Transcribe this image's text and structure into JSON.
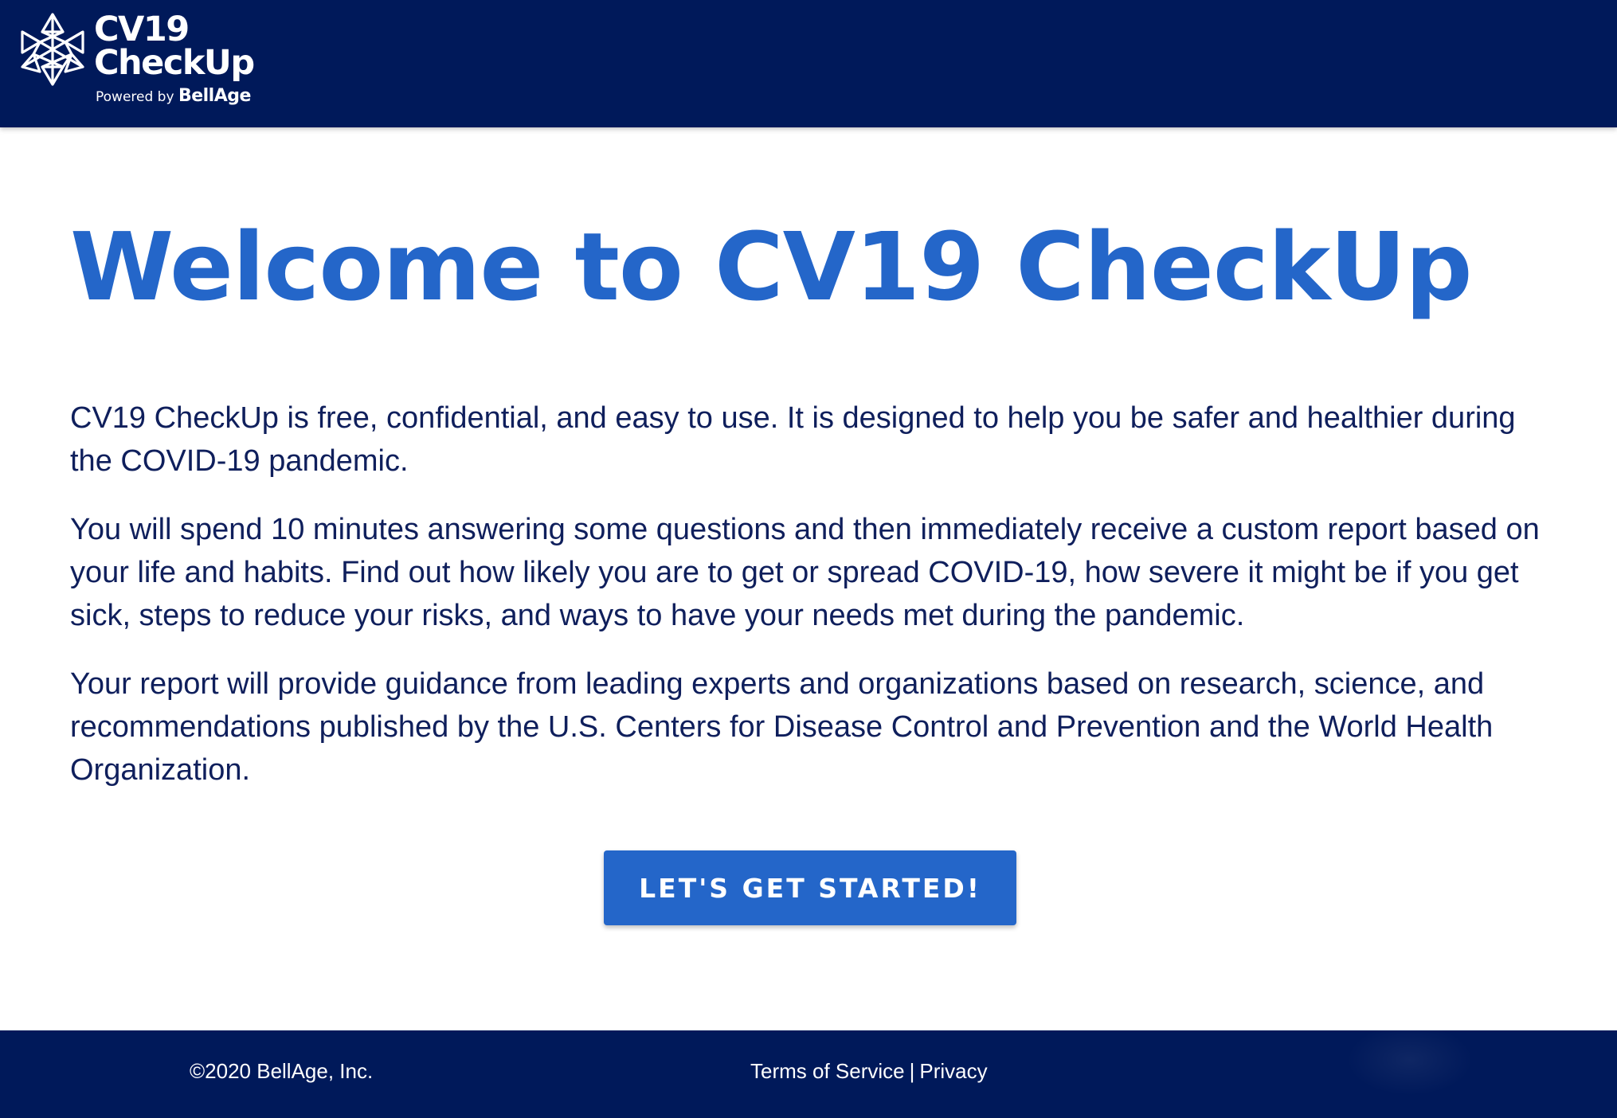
{
  "header": {
    "logo": {
      "title_line1": "CV19",
      "title_line2": "CheckUp",
      "powered_prefix": "Powered by",
      "powered_brand": "BellAge",
      "icon": "snowflake-network-icon"
    },
    "background_color": "#00195a"
  },
  "main": {
    "heading": "Welcome to CV19 CheckUp",
    "paragraphs": [
      "CV19 CheckUp is free, confidential, and easy to use. It is designed to help you be safer and healthier during the COVID-19 pandemic.",
      "You will spend 10 minutes answering some questions and then immediately receive a custom report based on your life and habits. Find out how likely you are to get or spread COVID-19, how severe it might be if you get sick, steps to reduce your risks, and ways to have your needs met during the pandemic.",
      "Your report will provide guidance from leading experts and organizations based on research, science, and recommendations published by the U.S. Centers for Disease Control and Prevention and the World Health Organization."
    ],
    "cta_label": "LET'S GET STARTED!"
  },
  "footer": {
    "copyright": "©2020 BellAge, Inc.",
    "terms_label": "Terms of Service",
    "separator": "|",
    "privacy_label": "Privacy"
  },
  "colors": {
    "navy": "#00195a",
    "accent_blue": "#2466c9",
    "body_text": "#0f1f5c",
    "white": "#ffffff"
  }
}
